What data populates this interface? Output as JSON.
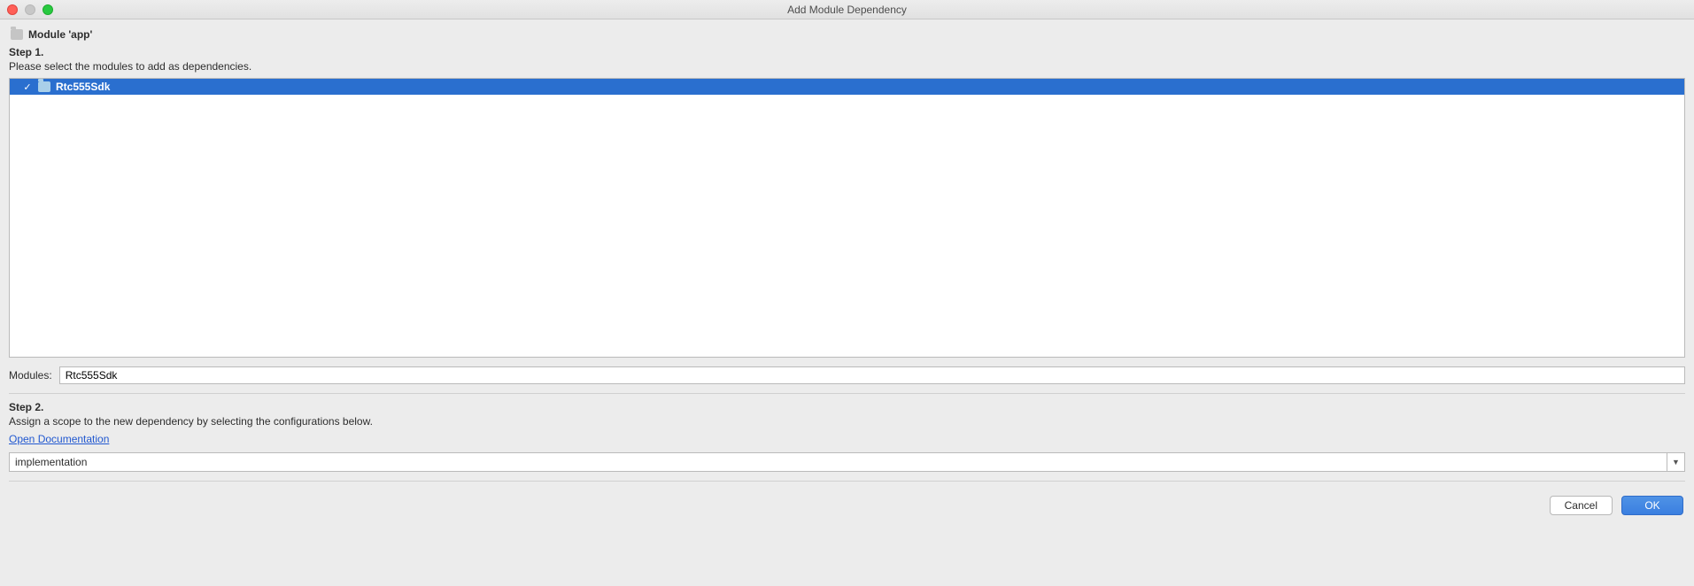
{
  "window": {
    "title": "Add Module Dependency"
  },
  "breadcrumb": {
    "module_label": "Module 'app'"
  },
  "step1": {
    "title": "Step 1.",
    "description": "Please select the modules to add as dependencies."
  },
  "modules": {
    "list": [
      {
        "name": "Rtc555Sdk",
        "checked": true,
        "selected": true
      }
    ],
    "input_label": "Modules:",
    "input_value": "Rtc555Sdk"
  },
  "step2": {
    "title": "Step 2.",
    "description": "Assign a scope to the new dependency by selecting the configurations below.",
    "doc_link": "Open Documentation"
  },
  "scope": {
    "selected": "implementation"
  },
  "buttons": {
    "cancel": "Cancel",
    "ok": "OK"
  }
}
